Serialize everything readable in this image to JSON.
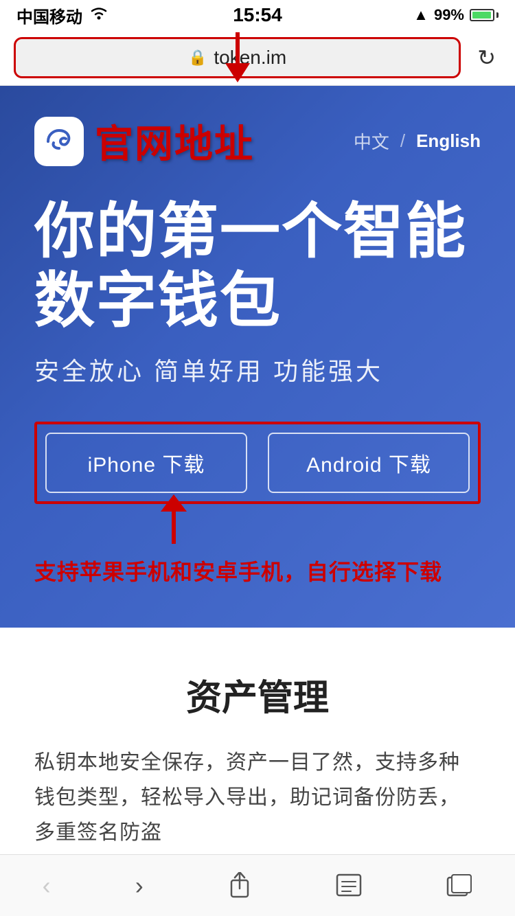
{
  "statusBar": {
    "carrier": "中国移动",
    "time": "15:54",
    "signal": "▲",
    "battery": "99%"
  },
  "browserBar": {
    "url": "token.im",
    "refreshLabel": "↻"
  },
  "hero": {
    "logoIcon": "ε",
    "siteTitle": "官网地址",
    "langChinese": "中文",
    "langDivider": "/",
    "langEnglish": "English",
    "mainTitle": "你的第一个智能数字钱包",
    "subtitle": "安全放心  简单好用  功能强大",
    "iphoneBtn": "iPhone 下载",
    "androidBtn": "Android 下载",
    "annotationText": "支持苹果手机和安卓手机，自行选择下载"
  },
  "contentSection": {
    "title": "资产管理",
    "body": "私钥本地安全保存，资产一目了然，支持多种钱包类型，轻松导入导出，助记词备份防丢，多重签名防盗"
  },
  "bottomNav": {
    "backLabel": "‹",
    "forwardLabel": "›",
    "shareLabel": "⬆",
    "bookmarkLabel": "⊟",
    "tabsLabel": "⧉"
  }
}
